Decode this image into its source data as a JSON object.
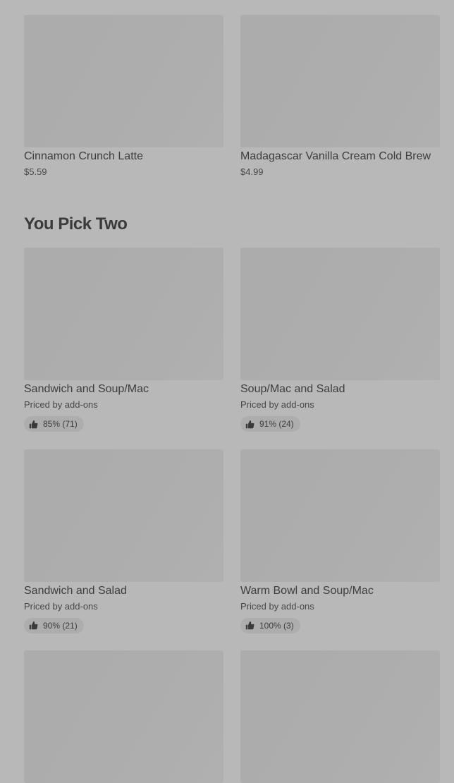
{
  "featured": [
    {
      "name": "Cinnamon Crunch Latte",
      "price": "$5.59"
    },
    {
      "name": "Madagascar Vanilla Cream Cold Brew",
      "price": "$4.99"
    }
  ],
  "section": {
    "title": "You Pick Two",
    "items": [
      {
        "name": "Sandwich and Soup/Mac",
        "price": "Priced by add-ons",
        "rating": "85% (71)"
      },
      {
        "name": "Soup/Mac and Salad",
        "price": "Priced by add-ons",
        "rating": "91% (24)"
      },
      {
        "name": "Sandwich and Salad",
        "price": "Priced by add-ons",
        "rating": "90% (21)"
      },
      {
        "name": "Warm Bowl and Soup/Mac",
        "price": "Priced by add-ons",
        "rating": "100% (3)"
      }
    ]
  },
  "icons": {
    "rating": "thumbs-up-icon"
  }
}
